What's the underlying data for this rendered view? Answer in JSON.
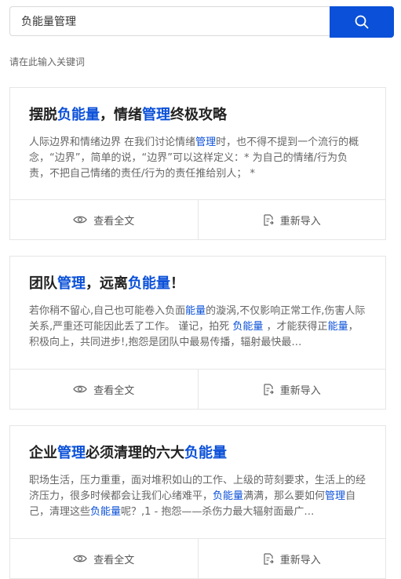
{
  "search": {
    "value": "负能量管理",
    "placeholder": "请在此输入关键词",
    "hint": "请在此输入关键词"
  },
  "results": [
    {
      "title_parts": [
        {
          "text": "摆脱",
          "hl": false
        },
        {
          "text": "负能量",
          "hl": true
        },
        {
          "text": "，情绪",
          "hl": false
        },
        {
          "text": "管理",
          "hl": true
        },
        {
          "text": "终极攻略",
          "hl": false
        }
      ],
      "desc_parts": [
        {
          "text": "人际边界和情绪边界 在我们讨论情绪",
          "hl": false
        },
        {
          "text": "管理",
          "hl": true
        },
        {
          "text": "时，也不得不提到一个流行的概念，“边界”，简单的说，“边界”可以这样定义：* 为自己的情绪/行为负责，不把自己情绪的责任/行为的责任推给别人； *",
          "hl": false
        }
      ],
      "view_label": "查看全文",
      "import_label": "重新导入"
    },
    {
      "title_parts": [
        {
          "text": "团队",
          "hl": false
        },
        {
          "text": "管理",
          "hl": true
        },
        {
          "text": "，远离",
          "hl": false
        },
        {
          "text": "负能量",
          "hl": true
        },
        {
          "text": "！",
          "hl": false
        }
      ],
      "desc_parts": [
        {
          "text": "若你稍不留心,自己也可能卷入负面",
          "hl": false
        },
        {
          "text": "能量",
          "hl": true
        },
        {
          "text": "的漩涡,不仅影响正常工作,伤害人际关系,严重还可能因此丢了工作。 谨记，拍死 ",
          "hl": false
        },
        {
          "text": "负能量",
          "hl": true
        },
        {
          "text": " ，才能获得正",
          "hl": false
        },
        {
          "text": "能量",
          "hl": true
        },
        {
          "text": "，积极向上，共同进步!,抱怨是团队中最易传播，辐射最快最…",
          "hl": false
        }
      ],
      "view_label": "查看全文",
      "import_label": "重新导入"
    },
    {
      "title_parts": [
        {
          "text": "企业",
          "hl": false
        },
        {
          "text": "管理",
          "hl": true
        },
        {
          "text": "必须清理的六大",
          "hl": false
        },
        {
          "text": "负能量",
          "hl": true
        }
      ],
      "desc_parts": [
        {
          "text": "职场生活，压力重重，面对堆积如山的工作、上级的苛刻要求，生活上的经济压力，很多时候都会让我们心绪难平，",
          "hl": false
        },
        {
          "text": "负能量",
          "hl": true
        },
        {
          "text": "满满，那么要如何",
          "hl": false
        },
        {
          "text": "管理",
          "hl": true
        },
        {
          "text": "自己，清理这些",
          "hl": false
        },
        {
          "text": "负能量",
          "hl": true
        },
        {
          "text": "呢？,1 - 抱怨——杀伤力最大辐射面最广…",
          "hl": false
        }
      ],
      "view_label": "查看全文",
      "import_label": "重新导入"
    }
  ],
  "colors": {
    "accent": "#0a50d8",
    "border": "#e6e6e6",
    "text_muted": "#666666"
  },
  "icons": {
    "search": "search-icon",
    "view": "eye-icon",
    "import": "import-document-icon"
  }
}
